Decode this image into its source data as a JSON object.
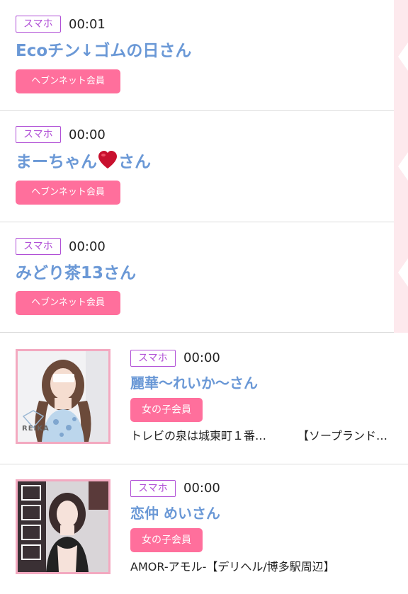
{
  "device_badge": "スマホ",
  "entries": [
    {
      "time": "00:01",
      "name": "Ecoチン↓ゴムの日さん",
      "member": "ヘブンネット会員"
    },
    {
      "time": "00:00",
      "name_text": "まーちゃん",
      "name_suffix": "さん",
      "member": "ヘブンネット会員"
    },
    {
      "time": "00:00",
      "name": "みどり茶13さん",
      "member": "ヘブンネット会員"
    },
    {
      "time": "00:00",
      "name": "麗華〜れいか〜さん",
      "member": "女の子会員",
      "shop_left": "トレビの泉は城東町１番…",
      "shop_right": "【ソープランド…",
      "thumb_caption": "REIKA"
    },
    {
      "time": "00:00",
      "name": "恋仲 めいさん",
      "member": "女の子会員",
      "shop": "AMOR-アモル-【デリヘル/博多駅周辺】"
    }
  ],
  "colors": {
    "badge": "#b04fd6",
    "name": "#6a98d6",
    "member_button": "#ff6f9c"
  }
}
